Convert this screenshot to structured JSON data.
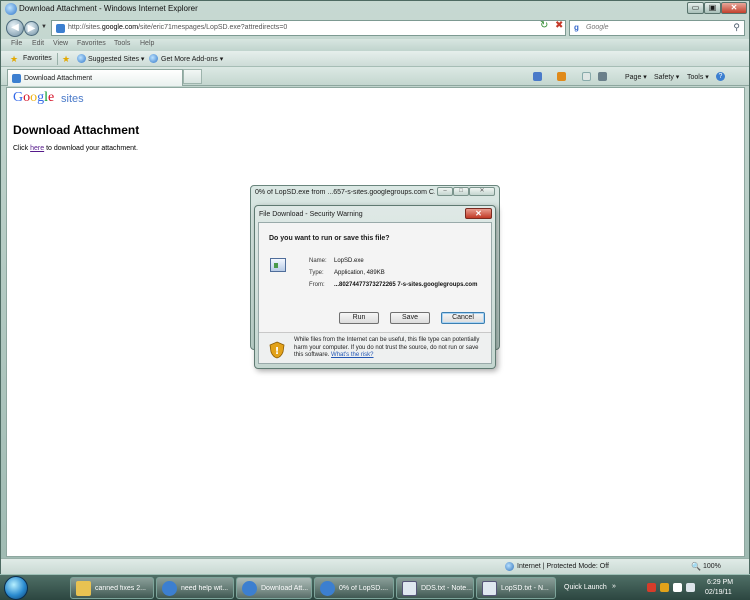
{
  "window": {
    "title": "Download Attachment - Windows Internet Explorer",
    "min_glyph": "▭",
    "max_glyph": "▣",
    "close_glyph": "✕"
  },
  "address": {
    "url_prefix": "http://sites.",
    "url_domain": "google.com",
    "url_suffix": "/site/eric71mespages/LopSD.exe?attredirects=0",
    "search_placeholder": "Google"
  },
  "menu": {
    "items": [
      "File",
      "Edit",
      "View",
      "Favorites",
      "Tools",
      "Help"
    ]
  },
  "favorites": {
    "label": "Favorites",
    "links": [
      "Suggested Sites ▾",
      "Get More Add-ons ▾"
    ]
  },
  "tabs": {
    "active_label": "Download Attachment"
  },
  "commands": {
    "page": "Page ▾",
    "safety": "Safety ▾",
    "tools": "Tools ▾",
    "help": "?"
  },
  "page": {
    "logo_letters": [
      "G",
      "o",
      "o",
      "g",
      "l",
      "e"
    ],
    "logo_colors": [
      "#3369e8",
      "#d50f25",
      "#eeb211",
      "#3369e8",
      "#009925",
      "#d50f25"
    ],
    "logo_sub": "sites",
    "heading": "Download Attachment",
    "text_before": "Click ",
    "link": "here",
    "text_after": " to download your attachment."
  },
  "progress_window": {
    "title": "0% of LopSD.exe from ...657-s-sites.googlegroups.com C..."
  },
  "security_dialog": {
    "title": "File Download - Security Warning",
    "question": "Do you want to run or save this file?",
    "name_label": "Name:",
    "name_value": "LopSD.exe",
    "type_label": "Type:",
    "type_value": "Application, 489KB",
    "from_label": "From:",
    "from_value": "...80274477373272265 7-s-sites.googlegroups.com",
    "run": "Run",
    "save": "Save",
    "cancel": "Cancel",
    "warning": "While files from the Internet can be useful, this file type can potentially harm your computer. If you do not trust the source, do not run or save this software.",
    "risk_link": "What's the risk?"
  },
  "status": {
    "zone": "Internet | Protected Mode: Off",
    "zoom": "100%"
  },
  "taskbar": {
    "buttons": [
      "canned fixes 2...",
      "need help wit...",
      "Download Att...",
      "0% of LopSD....",
      "DDS.txt - Note...",
      "LopSD.txt - N..."
    ],
    "quick_launch": "Quick Launch",
    "time": "6:29 PM",
    "date": "02/19/11"
  },
  "colors": {
    "accent": "#3c7fd0",
    "close_red": "#c23a26"
  }
}
